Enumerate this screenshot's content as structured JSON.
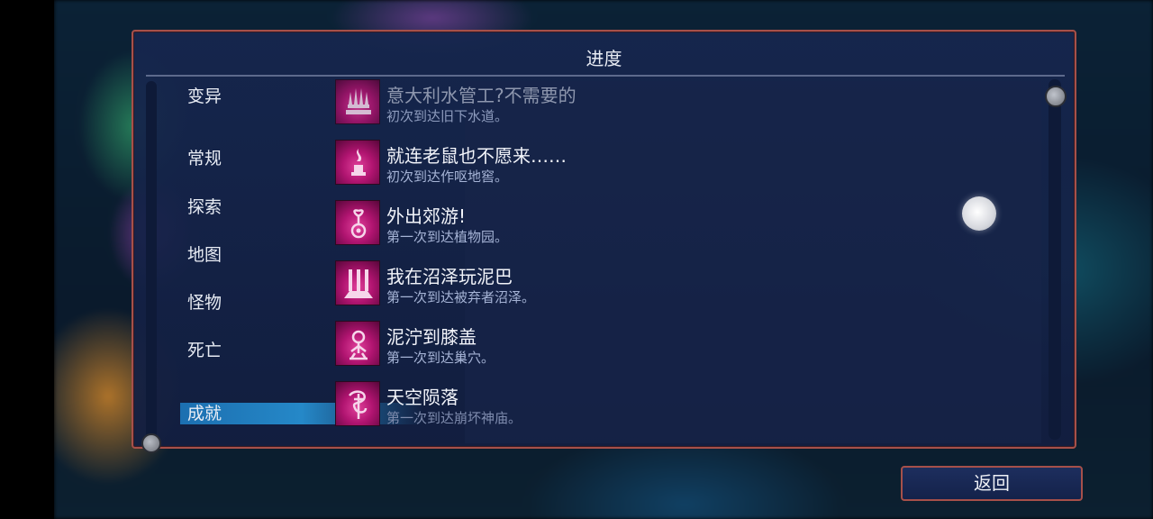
{
  "panel": {
    "title": "进度"
  },
  "categories": [
    {
      "label": "变异",
      "selected": false
    },
    {
      "label": "常规",
      "selected": false
    },
    {
      "label": "探索",
      "selected": false
    },
    {
      "label": "地图",
      "selected": false
    },
    {
      "label": "怪物",
      "selected": false
    },
    {
      "label": "死亡",
      "selected": false
    },
    {
      "label": "成就",
      "selected": true
    }
  ],
  "achievements": [
    {
      "title": "意大利水管工?不需要的",
      "desc": "初次到达旧下水道。",
      "icon": "crown-spikes-icon"
    },
    {
      "title": "就连老鼠也不愿来……",
      "desc": "初次到达作呕地窖。",
      "icon": "vial-flame-icon"
    },
    {
      "title": "外出郊游!",
      "desc": "第一次到达植物园。",
      "icon": "flower-pot-icon"
    },
    {
      "title": "我在沼泽玩泥巴",
      "desc": "第一次到达被弃者沼泽。",
      "icon": "swamp-pillars-icon"
    },
    {
      "title": "泥泞到膝盖",
      "desc": "第一次到达巢穴。",
      "icon": "tree-creature-icon"
    },
    {
      "title": "天空陨落",
      "desc": "第一次到达崩坏神庙。",
      "icon": "serpent-dagger-icon"
    }
  ],
  "back_button": {
    "label": "返回"
  },
  "colors": {
    "accent_border": "#a6504a",
    "selected": "#2588c8",
    "icon_magenta": "#c0187a"
  }
}
